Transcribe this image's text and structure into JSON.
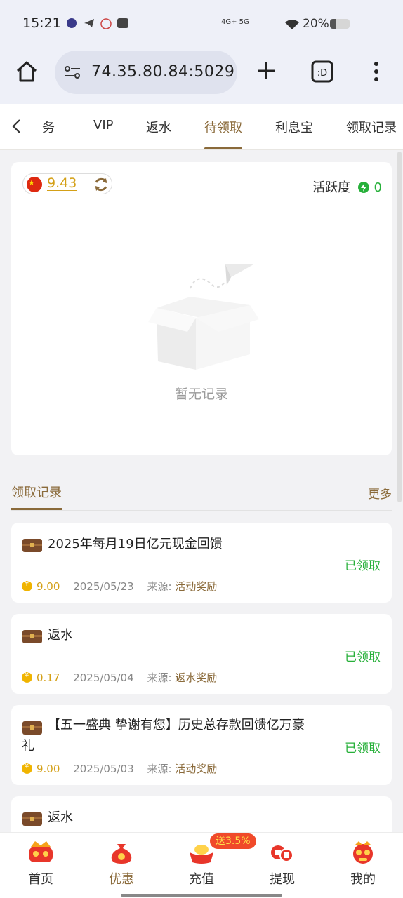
{
  "status_bar": {
    "time": "15:21",
    "network": "4G+ 5G",
    "battery": "20%"
  },
  "browser": {
    "url": "74.35.80.84:5029",
    "icons": [
      "home-icon",
      "site-settings-icon",
      "new-tab-plus-icon",
      "tab-switcher-icon",
      "overflow-menu-icon"
    ]
  },
  "tabs": {
    "items": [
      "任务",
      "VIP",
      "返水",
      "待领取",
      "利息宝",
      "领取记录"
    ],
    "visible_first": "务",
    "active": "待领取"
  },
  "balance": {
    "amount": "9.43",
    "activity_label": "活跃度",
    "activity_value": "0"
  },
  "empty_state": {
    "text": "暂无记录"
  },
  "records_section": {
    "title": "领取记录",
    "more": "更多"
  },
  "records": [
    {
      "title": "2025年每月19日亿元现金回馈",
      "status": "已领取",
      "amount": "9.00",
      "date": "2025/05/23",
      "source_label": "来源:",
      "source": "活动奖励"
    },
    {
      "title": "返水",
      "status": "已领取",
      "amount": "0.17",
      "date": "2025/05/04",
      "source_label": "来源:",
      "source": "返水奖励"
    },
    {
      "title": "【五一盛典 挚谢有您】历史总存款回馈亿万豪礼",
      "status": "已领取",
      "amount": "9.00",
      "date": "2025/05/03",
      "source_label": "来源:",
      "source": "活动奖励"
    },
    {
      "title": "返水"
    }
  ],
  "bottom_nav": {
    "items": [
      "首页",
      "优惠",
      "充值",
      "提现",
      "我的"
    ],
    "active": "优惠",
    "promo_badge": "送3.5%"
  },
  "colors": {
    "accent": "#8a6a3a",
    "gold": "#d4a017",
    "success": "#27b03a",
    "badge": "#f04a2a"
  }
}
